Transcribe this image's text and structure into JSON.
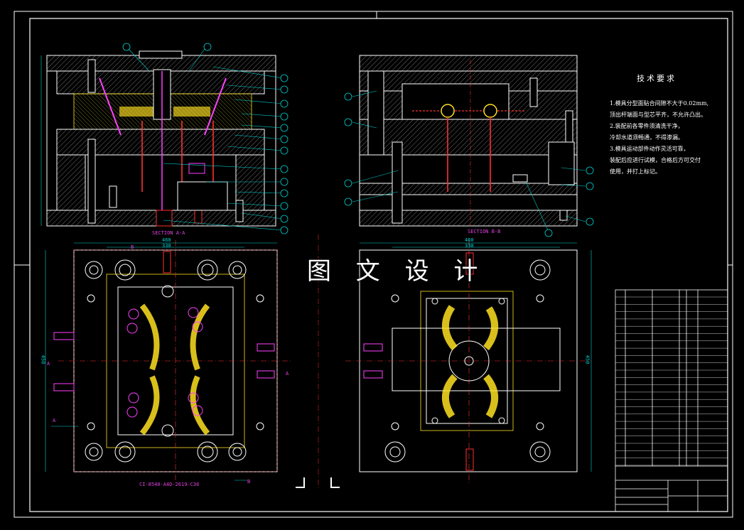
{
  "watermark": "图 文 设 计",
  "section_labels": {
    "a": "SECTION A-A",
    "b": "SECTION B-B"
  },
  "markers": {
    "a": "A",
    "b": "B"
  },
  "dimensions": {
    "top_left_w1": "460",
    "top_left_w2": "330",
    "top_right_w1": "460",
    "top_right_w2": "330",
    "left_h": "450",
    "right_h": "450"
  },
  "part_number": "CI-8540-A4D-2619-C36",
  "tech_requirements": {
    "title": "技术要求",
    "lines": [
      "1.模具分型面贴合间隙不大于0.02mm,",
      "顶出杆端面与型芯平齐，不允许凸出。",
      "2.装配前各零件须清洗干净，",
      "冷却水道须畅通，不得渗漏。",
      "3.模具运动部件动作灵活可靠，",
      "装配后应进行试模，合格后方可交付",
      "使用，并打上标记。"
    ]
  },
  "colors": {
    "background": "#000000",
    "frame": "#ffffff",
    "wall": "#d8d8d8",
    "leader": "#00d0d0",
    "section": "#e040e0",
    "part": "#ff40ff",
    "insert": "#ffe020",
    "red": "#ff3030",
    "accent_green": "#40ff40"
  }
}
